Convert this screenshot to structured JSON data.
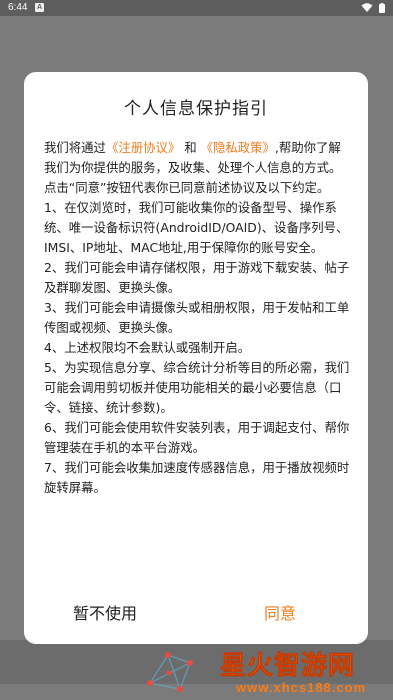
{
  "status_bar": {
    "time": "6:44",
    "app_icon": "A",
    "wifi_icon": "wifi-icon",
    "battery_icon": "battery-icon"
  },
  "dialog": {
    "title": "个人信息保护指引",
    "intro_before": "我们将通过",
    "link_register": "《注册协议》",
    "intro_and": " 和 ",
    "link_privacy": "《隐私政策》",
    "intro_after": ",帮助你了解我们为你提供的服务，及收集、处理个人信息的方式。",
    "paragraphs": [
      " 点击“同意”按钮代表你已同意前述协议及以下约定。",
      " 1、在仅浏览时，我们可能收集你的设备型号、操作系统、唯一设备标识符(AndroidID/OAID)、设备序列号、IMSI、IP地址、MAC地址,用于保障你的账号安全。",
      " 2、我们可能会申请存储权限，用于游戏下载安装、帖子及群聊发图、更换头像。",
      " 3、我们可能会申请摄像头或相册权限，用于发帖和工单传图或视频、更换头像。",
      " 4、上述权限均不会默认或强制开启。",
      " 5、为实现信息分享、综合统计分析等目的所必需，我们可能会调用剪切板并使用功能相关的最小必要信息（口令、链接、统计参数)。",
      " 6、我们可能会使用软件安装列表，用于调起支付、帮你管理装在手机的本平台游戏。",
      " 7、我们可能会收集加速度传感器信息，用于播放视频时旋转屏幕。"
    ],
    "cancel_label": "暂不使用",
    "agree_label": "同意"
  },
  "watermark": {
    "name": "星火智游网",
    "url": "www.xhcs188.com"
  },
  "colors": {
    "accent": "#f07d1e",
    "overlay": "#7b7b7b"
  }
}
